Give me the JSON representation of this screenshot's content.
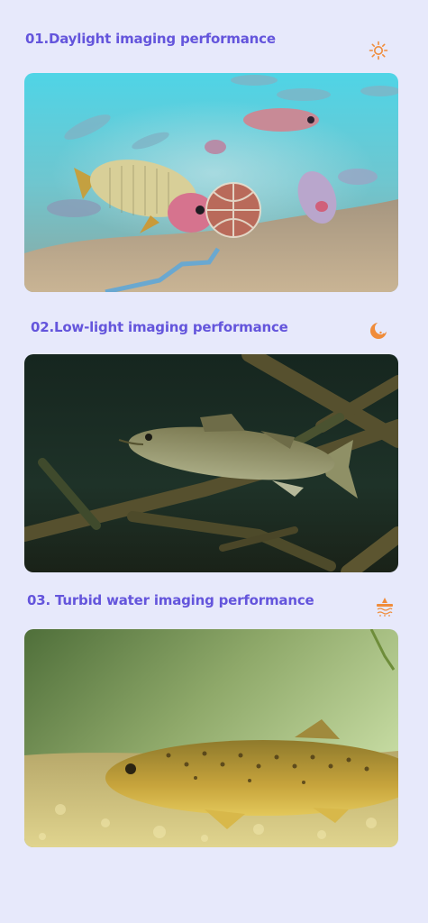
{
  "colors": {
    "title": "#6455dc",
    "background": "#e7e9fb",
    "icon_orange": "#f08c3a"
  },
  "sections": [
    {
      "title": "01.Daylight imaging performance",
      "icon": "sun-icon",
      "image": "daylight-underwater-carp-photo"
    },
    {
      "title": "02.Low-light imaging performance",
      "icon": "moon-icon",
      "image": "lowlight-underwater-bass-photo"
    },
    {
      "title": "03. Turbid water imaging performance",
      "icon": "turbid-water-icon",
      "image": "turbid-underwater-trout-photo"
    }
  ]
}
